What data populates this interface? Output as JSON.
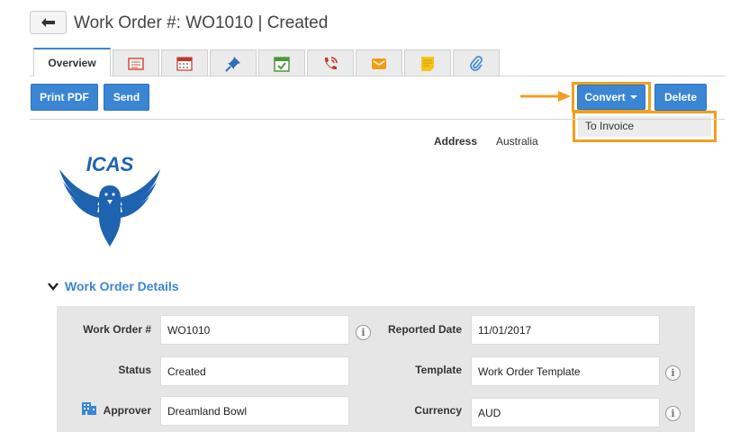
{
  "header": {
    "back_icon": "back-arrow-icon",
    "title": "Work Order #: WO1010 | Created"
  },
  "tabs": [
    {
      "label": "Overview",
      "icon": null
    },
    {
      "label": "",
      "icon": "details-icon"
    },
    {
      "label": "",
      "icon": "calendar-icon"
    },
    {
      "label": "",
      "icon": "pin-icon"
    },
    {
      "label": "",
      "icon": "task-icon"
    },
    {
      "label": "",
      "icon": "call-icon"
    },
    {
      "label": "",
      "icon": "email-icon"
    },
    {
      "label": "",
      "icon": "note-icon"
    },
    {
      "label": "",
      "icon": "attachment-icon"
    }
  ],
  "toolbar": {
    "print_pdf": "Print PDF",
    "send": "Send",
    "convert": "Convert",
    "delete": "Delete"
  },
  "convert_menu": {
    "items": [
      "To Invoice"
    ]
  },
  "address": {
    "label": "Address",
    "value": "Australia"
  },
  "logo": {
    "text": "ICAS"
  },
  "section": {
    "title": "Work Order Details"
  },
  "details": {
    "work_order_label": "Work Order #",
    "work_order_value": "WO1010",
    "reported_date_label": "Reported Date",
    "reported_date_value": "11/01/2017",
    "status_label": "Status",
    "status_value": "Created",
    "template_label": "Template",
    "template_value": "Work Order Template",
    "approver_label": "Approver",
    "approver_value": "Dreamland Bowl",
    "currency_label": "Currency",
    "currency_value": "AUD",
    "info_glyph": "i"
  },
  "colors": {
    "accent": "#3a86d4",
    "highlight": "#f0a020",
    "panel": "#e6e6e6"
  }
}
